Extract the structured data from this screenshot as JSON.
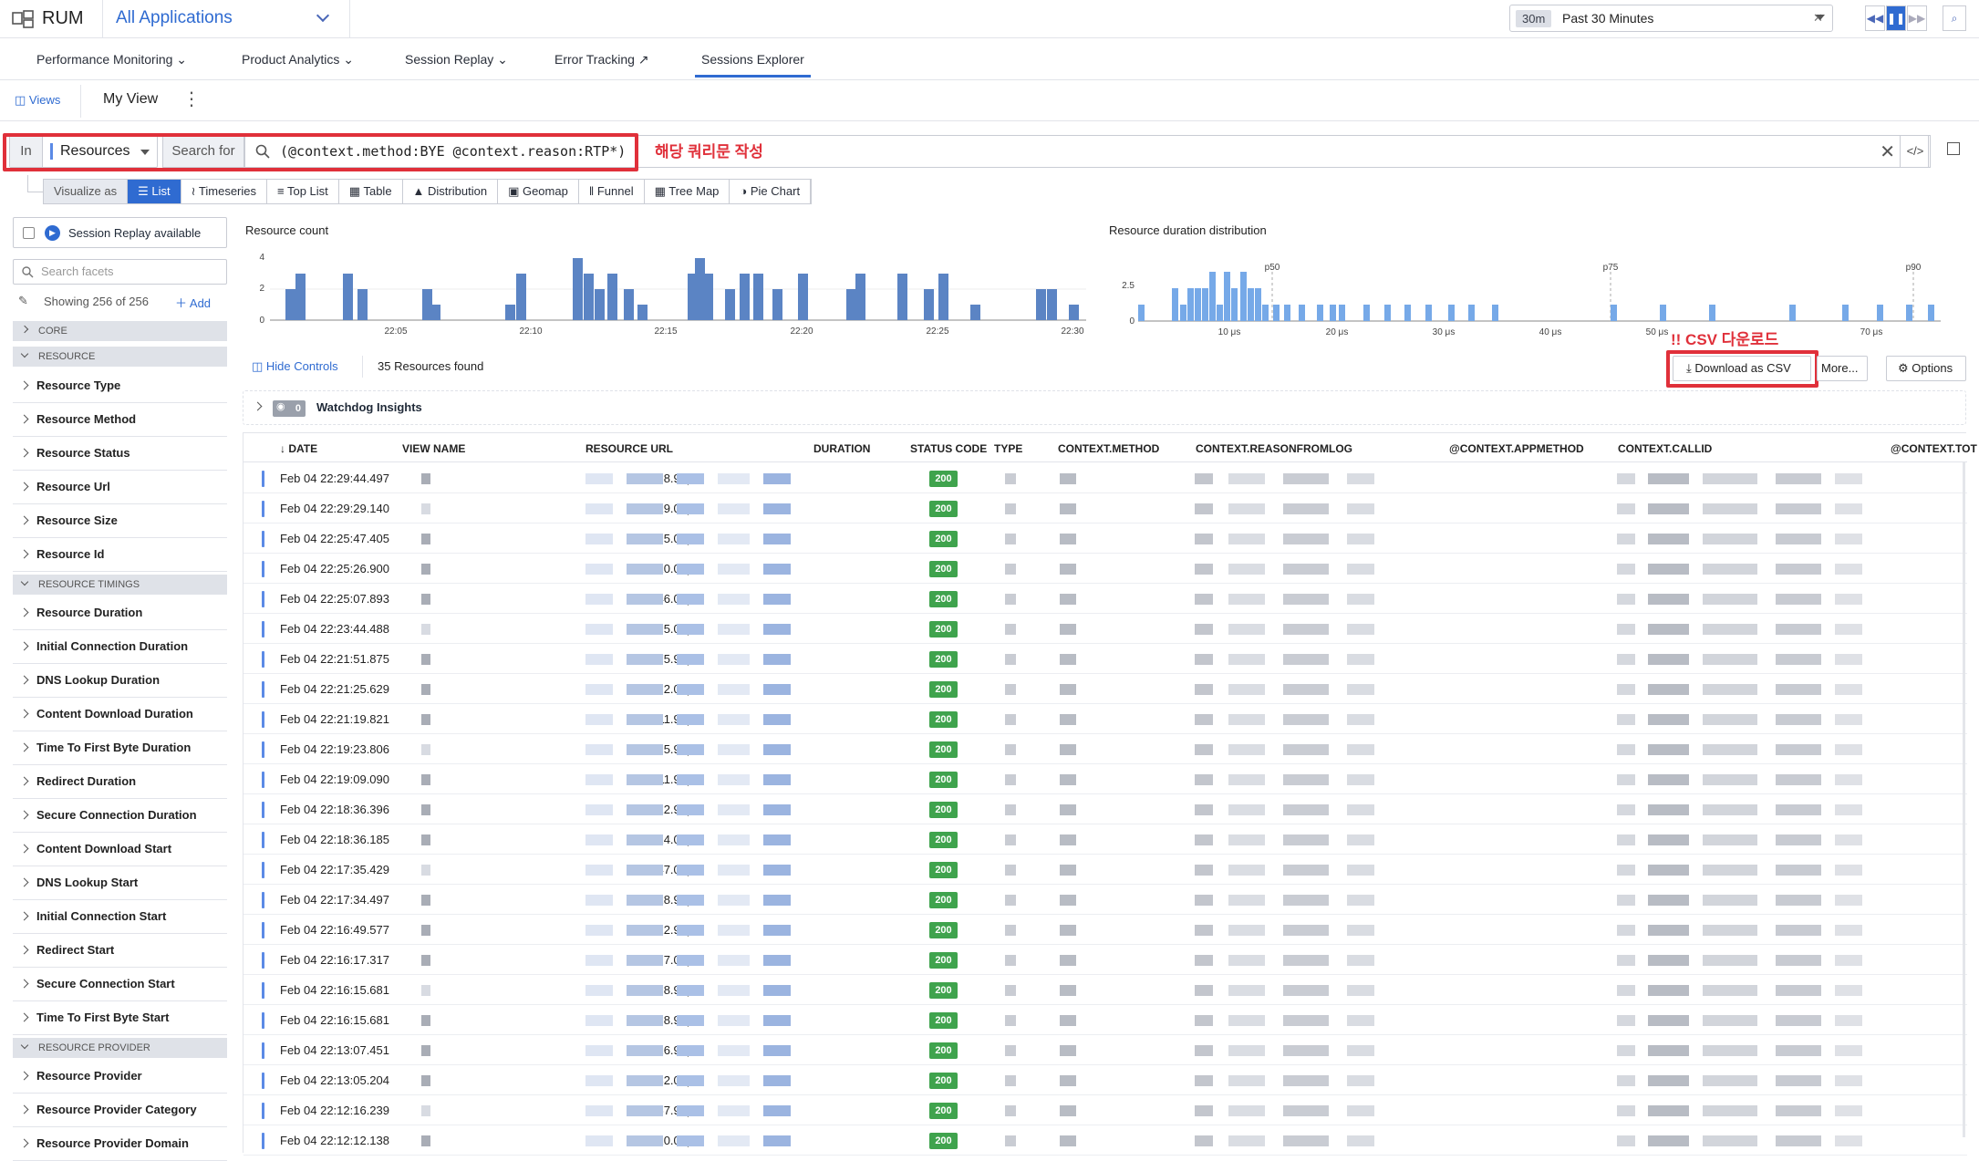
{
  "top": {
    "product": "RUM",
    "app": "All Applications",
    "time_badge": "30m",
    "time_label": "Past 30 Minutes"
  },
  "nav": [
    "Performance Monitoring",
    "Product Analytics",
    "Session Replay",
    "Error Tracking",
    "Sessions Explorer"
  ],
  "views": {
    "label": "Views",
    "current": "My View"
  },
  "query": {
    "in_label": "In",
    "source": "Resources",
    "search_for": "Search for",
    "text": "(@context.method:BYE @context.reason:RTP*)",
    "annotation": "해당 쿼리문 작성"
  },
  "visualize": {
    "label": "Visualize as",
    "options": [
      "List",
      "Timeseries",
      "Top List",
      "Table",
      "Distribution",
      "Geomap",
      "Funnel",
      "Tree Map",
      "Pie Chart"
    ]
  },
  "sidebar": {
    "replay": "Session Replay available",
    "search_placeholder": "Search facets",
    "showing": "Showing 256 of 256",
    "add": "Add",
    "sections": [
      "CORE",
      "RESOURCE",
      "RESOURCE TIMINGS",
      "RESOURCE PROVIDER"
    ],
    "resource": [
      "Resource Type",
      "Resource Method",
      "Resource Status",
      "Resource Url",
      "Resource Size",
      "Resource Id"
    ],
    "timings": [
      "Resource Duration",
      "Initial Connection Duration",
      "DNS Lookup Duration",
      "Content Download Duration",
      "Time To First Byte Duration",
      "Redirect Duration",
      "Secure Connection Duration",
      "Content Download Start",
      "DNS Lookup Start",
      "Initial Connection Start",
      "Redirect Start",
      "Secure Connection Start",
      "Time To First Byte Start"
    ],
    "provider": [
      "Resource Provider",
      "Resource Provider Category",
      "Resource Provider Domain"
    ]
  },
  "count_chart": {
    "title": "Resource count",
    "yticks": [
      "4",
      "2",
      "0"
    ],
    "xticks": [
      "22:05",
      "22:10",
      "22:15",
      "22:20",
      "22:25",
      "22:30"
    ]
  },
  "dist_chart": {
    "title": "Resource duration distribution",
    "yticks": [
      "2.5",
      "0"
    ],
    "xticks": [
      "10 μs",
      "20 μs",
      "30 μs",
      "40 μs",
      "50 μs",
      "70 μs"
    ],
    "percentiles": [
      "p50",
      "p75",
      "p90"
    ]
  },
  "toolbar": {
    "hide": "Hide Controls",
    "found": "35 Resources found",
    "csv": "Download as CSV",
    "csv_note": "!! CSV 다운로드",
    "more": "More...",
    "options": "Options"
  },
  "watchdog": {
    "count": "0",
    "label": "Watchdog Insights"
  },
  "columns": [
    "DATE",
    "VIEW NAME",
    "RESOURCE URL",
    "DURATION",
    "STATUS CODE",
    "TYPE",
    "CONTEXT.METHOD",
    "CONTEXT.REASONFROMLOG",
    "@CONTEXT.APPMETHOD",
    "CONTEXT.CALLID",
    "@CONTEXT.TOT"
  ],
  "rows": [
    {
      "date": "Feb 04 22:29:44.497",
      "duration": "8.94μs",
      "status": "200"
    },
    {
      "date": "Feb 04 22:29:29.140",
      "duration": "19.07μs",
      "status": "200"
    },
    {
      "date": "Feb 04 22:25:47.405",
      "duration": "5.01μs",
      "status": "200"
    },
    {
      "date": "Feb 04 22:25:26.900",
      "duration": "10.01μs",
      "status": "200"
    },
    {
      "date": "Feb 04 22:25:07.893",
      "duration": "46.02μs",
      "status": "200"
    },
    {
      "date": "Feb 04 22:23:44.488",
      "duration": "5.01μs",
      "status": "200"
    },
    {
      "date": "Feb 04 22:21:51.875",
      "duration": "75.94μs",
      "status": "200"
    },
    {
      "date": "Feb 04 22:21:25.629",
      "duration": "2.03μs",
      "status": "200"
    },
    {
      "date": "Feb 04 22:21:19.821",
      "duration": "11.92μs",
      "status": "200"
    },
    {
      "date": "Feb 04 22:19:23.806",
      "duration": "5.96μs",
      "status": "200"
    },
    {
      "date": "Feb 04 22:19:09.090",
      "duration": "11.92μs",
      "status": "200"
    },
    {
      "date": "Feb 04 22:18:36.396",
      "duration": "12.99μs",
      "status": "200"
    },
    {
      "date": "Feb 04 22:18:36.185",
      "duration": "14.07μs",
      "status": "200"
    },
    {
      "date": "Feb 04 22:17:35.429",
      "duration": "47.09μs",
      "status": "200"
    },
    {
      "date": "Feb 04 22:17:34.497",
      "duration": "28.97μs",
      "status": "200"
    },
    {
      "date": "Feb 04 22:16:49.577",
      "duration": "12.99μs",
      "status": "200"
    },
    {
      "date": "Feb 04 22:16:17.317",
      "duration": "7.03μs",
      "status": "200"
    },
    {
      "date": "Feb 04 22:16:15.681",
      "duration": "8.94μs",
      "status": "200"
    },
    {
      "date": "Feb 04 22:16:15.681",
      "duration": "8.94μs",
      "status": "200"
    },
    {
      "date": "Feb 04 22:13:07.451",
      "duration": "26.94μs",
      "status": "200"
    },
    {
      "date": "Feb 04 22:13:05.204",
      "duration": "32.07μs",
      "status": "200"
    },
    {
      "date": "Feb 04 22:12:16.239",
      "duration": "67.95μs",
      "status": "200"
    },
    {
      "date": "Feb 04 22:12:12.138",
      "duration": "10.01μs",
      "status": "200"
    }
  ]
}
